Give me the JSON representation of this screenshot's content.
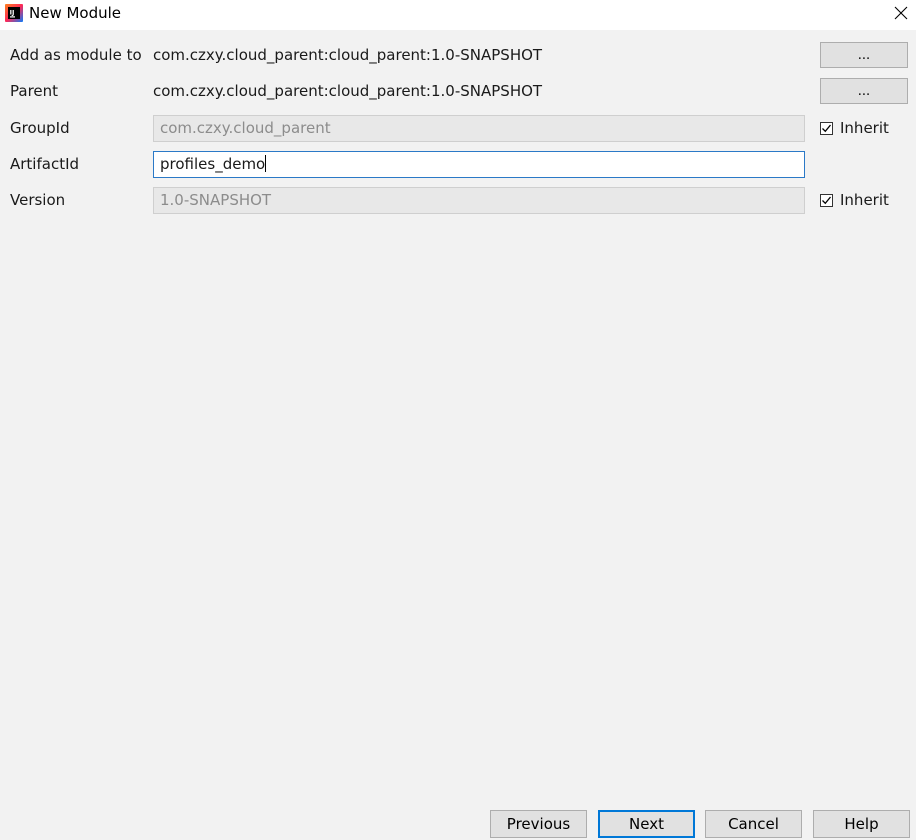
{
  "window": {
    "title": "New Module",
    "app_icon": "intellij-idea-icon",
    "close_icon": "close-icon"
  },
  "form": {
    "add_as_module_to": {
      "label": "Add as module to",
      "value": "com.czxy.cloud_parent:cloud_parent:1.0-SNAPSHOT",
      "button_label": "..."
    },
    "parent": {
      "label": "Parent",
      "value": "com.czxy.cloud_parent:cloud_parent:1.0-SNAPSHOT",
      "button_label": "..."
    },
    "group_id": {
      "label": "GroupId",
      "value": "com.czxy.cloud_parent",
      "inherit_label": "Inherit",
      "inherit_checked": true
    },
    "artifact_id": {
      "label": "ArtifactId",
      "value": "profiles_demo"
    },
    "version": {
      "label": "Version",
      "value": "1.0-SNAPSHOT",
      "inherit_label": "Inherit",
      "inherit_checked": true
    }
  },
  "footer": {
    "previous_label": "Previous",
    "next_label": "Next",
    "cancel_label": "Cancel",
    "help_label": "Help"
  },
  "colors": {
    "background": "#f2f2f2",
    "active_border": "#2b79c7",
    "default_button_border": "#0078d7"
  }
}
